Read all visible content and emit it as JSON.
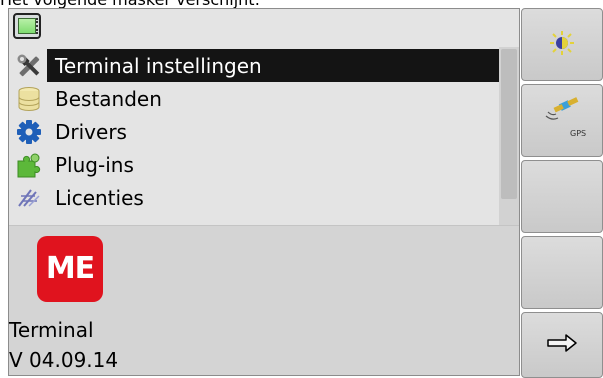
{
  "caption": "Het volgende masker verschijnt:",
  "menu": {
    "items": [
      {
        "label": "Terminal instellingen",
        "icon": "tools-icon",
        "selected": true
      },
      {
        "label": "Bestanden",
        "icon": "database-icon"
      },
      {
        "label": "Drivers",
        "icon": "gear-icon"
      },
      {
        "label": "Plug-ins",
        "icon": "puzzle-icon"
      },
      {
        "label": "Licenties",
        "icon": "license-icon"
      }
    ]
  },
  "info": {
    "logo_text": "ME",
    "name": "Terminal",
    "version": "V 04.09.14"
  },
  "softkeys": {
    "gps_label": "GPS",
    "items": [
      {
        "icon": "brightness-icon"
      },
      {
        "icon": "gps-icon"
      },
      {
        "icon": "empty"
      },
      {
        "icon": "empty"
      },
      {
        "icon": "arrow-right-icon"
      }
    ]
  },
  "colors": {
    "selection_bg": "#141414",
    "logo_red": "#e0131e",
    "panel_bg": "#e4e4e4",
    "info_bg": "#d4d4d4"
  }
}
